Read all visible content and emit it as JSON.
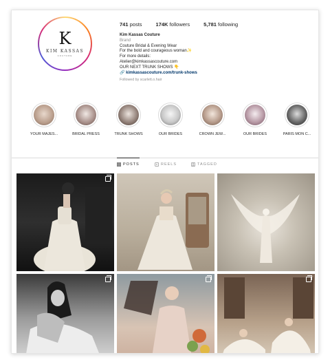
{
  "profile": {
    "logo_letter": "K",
    "logo_name": "KIM KASSAS",
    "logo_sub": "COUTURE",
    "stats": {
      "posts": "741",
      "posts_label": "posts",
      "followers": "174K",
      "followers_label": "followers",
      "following": "5,781",
      "following_label": "following"
    },
    "bio": {
      "name": "Kim Kassas Couture",
      "category": "Brand",
      "lines": [
        "Couture Bridal & Evening Wear",
        "For the bold and courageous woman✨",
        "For more details:",
        "Atelier@kimkassascouture.com",
        "OUR NEXT TRUNK SHOWS 👇"
      ],
      "link": "🔗 kimkassascouture.com/trunk-shows",
      "followed_by": "Followed by scarlett.o.hair"
    }
  },
  "highlights": [
    {
      "label": "YOUR MAJES...",
      "color": "#b89c8a"
    },
    {
      "label": "BRIDAL PRESS",
      "color": "#a58c86"
    },
    {
      "label": "TRUNK SHOWS",
      "color": "#8d7b73"
    },
    {
      "label": "OUR BRIDES",
      "color": "#c8c8c8"
    },
    {
      "label": "CROWN JEW...",
      "color": "#b79c8c"
    },
    {
      "label": "OUR BRIDES",
      "color": "#b89aa6"
    },
    {
      "label": "PARIS MON C...",
      "color": "#6a6a6a"
    }
  ],
  "tabs": {
    "posts": "POSTS",
    "reels": "REELS",
    "tagged": "TAGGED"
  },
  "colors": {
    "accent_link": "#00376b",
    "muted": "#8e8e8e"
  }
}
